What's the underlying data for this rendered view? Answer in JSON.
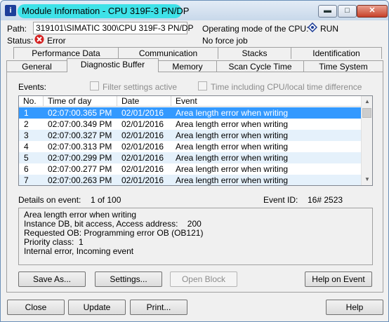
{
  "window": {
    "title": "Module Information - CPU 319F-3 PN/DP"
  },
  "info": {
    "path_label": "Path:",
    "path_value": "319101\\SIMATIC 300\\CPU 319F-3 PN/DP",
    "status_label": "Status:",
    "status_value": "Error",
    "opmode_label": "Operating mode of the  CPU:",
    "opmode_value": "RUN",
    "force_text": "No force job"
  },
  "tabs_row1": [
    "Performance Data",
    "Communication",
    "Stacks",
    "Identification"
  ],
  "tabs_row2": [
    "General",
    "Diagnostic Buffer",
    "Memory",
    "Scan Cycle Time",
    "Time System"
  ],
  "events": {
    "label": "Events:",
    "filter_label": "Filter settings active",
    "time_incl_label": "Time including CPU/local time difference",
    "columns": [
      "No.",
      "Time of day",
      "Date",
      "Event"
    ],
    "rows": [
      [
        "1",
        "02:07:00.365 PM",
        "02/01/2016",
        "Area length error when writing"
      ],
      [
        "2",
        "02:07:00.349 PM",
        "02/01/2016",
        "Area length error when writing"
      ],
      [
        "3",
        "02:07:00.327 PM",
        "02/01/2016",
        "Area length error when writing"
      ],
      [
        "4",
        "02:07:00.313 PM",
        "02/01/2016",
        "Area length error when writing"
      ],
      [
        "5",
        "02:07:00.299 PM",
        "02/01/2016",
        "Area length error when writing"
      ],
      [
        "6",
        "02:07:00.277 PM",
        "02/01/2016",
        "Area length error when writing"
      ],
      [
        "7",
        "02:07:00.263 PM",
        "02/01/2016",
        "Area length error when writing"
      ]
    ]
  },
  "details": {
    "label": "Details on event:",
    "count": "1 of 100",
    "event_id_label": "Event ID:",
    "event_id_value": "16# 2523",
    "lines": [
      "Area length error when writing",
      "Instance DB, bit access, Access address:    200",
      "Requested OB: Programming error OB (OB121)",
      "Priority class:  1",
      "Internal error, Incoming event"
    ]
  },
  "buttons": {
    "save_as": "Save As...",
    "settings": "Settings...",
    "open_block": "Open Block",
    "help_on_event": "Help on Event",
    "close": "Close",
    "update": "Update",
    "print": "Print...",
    "help": "Help"
  },
  "colors": {
    "title_highlight": "#3ee2e8",
    "selection": "#3399ff",
    "alt_row": "#e5f1fb",
    "error": "#d42020"
  }
}
